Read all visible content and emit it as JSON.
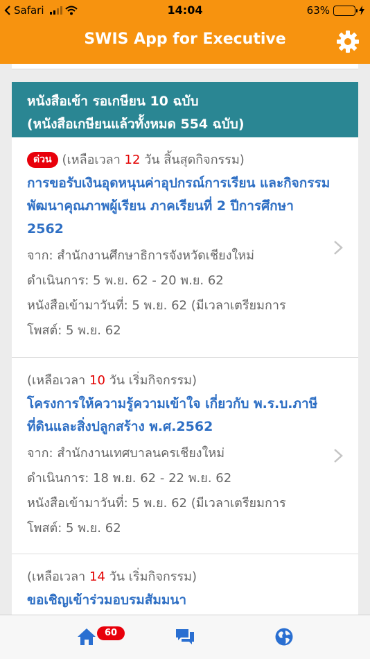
{
  "status_bar": {
    "carrier": "Safari",
    "time": "14:04",
    "battery_percent": "63%",
    "battery_level": 0.63
  },
  "header": {
    "title": "SWIS App for Executive",
    "settings_icon": "gear-icon",
    "accent_color": "#f7930f"
  },
  "summary": {
    "line1": "หนังสือเข้า รอเกษียน 10 ฉบับ",
    "line2": "(หนังสือเกษียนแล้วทั้งหมด 554 ฉบับ)",
    "color": "#2a8693"
  },
  "documents": [
    {
      "urgent_label": "ด่วน",
      "time_prefix": "(เหลือเวลา ",
      "time_num": "12",
      "time_suffix": " วัน สิ้นสุดกิจกรรม)",
      "title": "การขอรับเงินอุดหนุนค่าอุปกรณ์การเรียน และกิจกรรมพัฒนาคุณภาพผู้เรียน ภาคเรียนที่ 2 ปีการศึกษา 2562",
      "from": "จาก: สำนักงานศึกษาธิการจังหวัดเชียงใหม่",
      "period": "ดำเนินการ: 5 พ.ย. 62 - 20 พ.ย. 62",
      "received_1": "หนังสือเข้ามาวันที่: 5 พ.ย. 62 (มีเวลาเตรียมการ",
      "received_2": "โพสต์: 5 พ.ย. 62"
    },
    {
      "time_prefix": "(เหลือเวลา ",
      "time_num": "10",
      "time_suffix": " วัน เริ่มกิจกรรม)",
      "title": "โครงการให้ความรู้ความเข้าใจ เกี่ยวกับ พ.ร.บ.ภาษีที่ดินและสิ่งปลูกสร้าง พ.ศ.2562",
      "from": "จาก: สำนักงานเทศบาลนครเชียงใหม่",
      "period": "ดำเนินการ: 18 พ.ย. 62 - 22 พ.ย. 62",
      "received_1": "หนังสือเข้ามาวันที่: 5 พ.ย. 62 (มีเวลาเตรียมการ",
      "received_2": "โพสต์: 5 พ.ย. 62"
    },
    {
      "time_prefix": "(เหลือเวลา ",
      "time_num": "14",
      "time_suffix": " วัน เริ่มกิจกรรม)",
      "title": "ขอเชิญเข้าร่วมอบรมสัมมนา"
    }
  ],
  "tabbar": {
    "home_badge": "60",
    "tabs": [
      "home-icon",
      "chat-icon",
      "globe-icon"
    ]
  }
}
